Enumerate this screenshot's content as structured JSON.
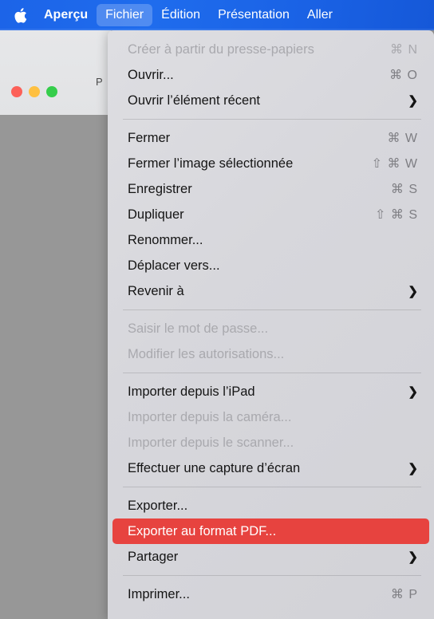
{
  "menubar": {
    "apple_icon": "apple-logo-icon",
    "items": [
      {
        "label": "Aperçu",
        "bold": true,
        "active": false
      },
      {
        "label": "Fichier",
        "bold": false,
        "active": true
      },
      {
        "label": "Édition",
        "bold": false,
        "active": false
      },
      {
        "label": "Présentation",
        "bold": false,
        "active": false
      },
      {
        "label": "Aller",
        "bold": false,
        "active": false
      }
    ]
  },
  "window": {
    "title_fragment": "P",
    "traffic_lights": {
      "close_color": "#fc6058",
      "minimize_color": "#fec041",
      "maximize_color": "#35cd4b"
    }
  },
  "menu": {
    "name": "Fichier",
    "highlight_color": "#e7433f",
    "items": [
      {
        "label": "Créer à partir du presse-papiers",
        "shortcut": "⌘ N",
        "chevron": "",
        "disabled": true,
        "highlighted": false
      },
      {
        "label": "Ouvrir...",
        "shortcut": "⌘ O",
        "chevron": "",
        "disabled": false,
        "highlighted": false
      },
      {
        "label": "Ouvrir l’élément récent",
        "shortcut": "",
        "chevron": "❯",
        "disabled": false,
        "highlighted": false
      },
      {
        "separator": true
      },
      {
        "label": "Fermer",
        "shortcut": "⌘ W",
        "chevron": "",
        "disabled": false,
        "highlighted": false
      },
      {
        "label": "Fermer l’image sélectionnée",
        "shortcut": "⇧ ⌘ W",
        "chevron": "",
        "disabled": false,
        "highlighted": false
      },
      {
        "label": "Enregistrer",
        "shortcut": "⌘ S",
        "chevron": "",
        "disabled": false,
        "highlighted": false
      },
      {
        "label": "Dupliquer",
        "shortcut": "⇧ ⌘ S",
        "chevron": "",
        "disabled": false,
        "highlighted": false
      },
      {
        "label": "Renommer...",
        "shortcut": "",
        "chevron": "",
        "disabled": false,
        "highlighted": false
      },
      {
        "label": "Déplacer vers...",
        "shortcut": "",
        "chevron": "",
        "disabled": false,
        "highlighted": false
      },
      {
        "label": "Revenir à",
        "shortcut": "",
        "chevron": "❯",
        "disabled": false,
        "highlighted": false
      },
      {
        "separator": true
      },
      {
        "label": "Saisir le mot de passe...",
        "shortcut": "",
        "chevron": "",
        "disabled": true,
        "highlighted": false
      },
      {
        "label": "Modifier les autorisations...",
        "shortcut": "",
        "chevron": "",
        "disabled": true,
        "highlighted": false
      },
      {
        "separator": true
      },
      {
        "label": "Importer depuis l’iPad",
        "shortcut": "",
        "chevron": "❯",
        "disabled": false,
        "highlighted": false
      },
      {
        "label": "Importer depuis la caméra...",
        "shortcut": "",
        "chevron": "",
        "disabled": true,
        "highlighted": false
      },
      {
        "label": "Importer depuis le scanner...",
        "shortcut": "",
        "chevron": "",
        "disabled": true,
        "highlighted": false
      },
      {
        "label": "Effectuer une capture d’écran",
        "shortcut": "",
        "chevron": "❯",
        "disabled": false,
        "highlighted": false
      },
      {
        "separator": true
      },
      {
        "label": "Exporter...",
        "shortcut": "",
        "chevron": "",
        "disabled": false,
        "highlighted": false
      },
      {
        "label": "Exporter au format PDF...",
        "shortcut": "",
        "chevron": "",
        "disabled": false,
        "highlighted": true
      },
      {
        "label": "Partager",
        "shortcut": "",
        "chevron": "❯",
        "disabled": false,
        "highlighted": false
      },
      {
        "separator": true
      },
      {
        "label": "Imprimer...",
        "shortcut": "⌘ P",
        "chevron": "",
        "disabled": false,
        "highlighted": false
      }
    ]
  }
}
